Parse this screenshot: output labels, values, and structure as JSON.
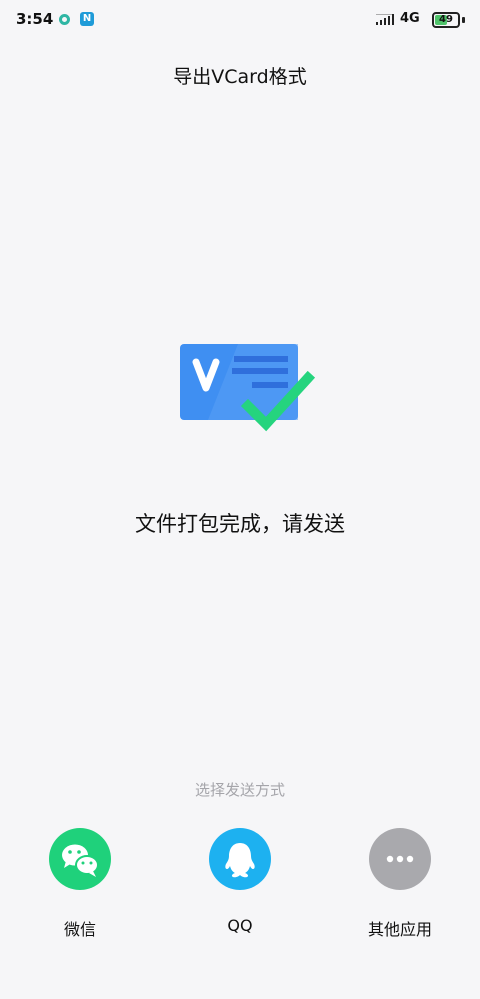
{
  "status_bar": {
    "time": "3:54",
    "network": "4G",
    "battery_level": "49",
    "battery_fraction": 0.49,
    "icons": [
      "app-ring-icon",
      "notification-n-icon",
      "signal-icon",
      "battery-icon"
    ]
  },
  "header": {
    "title": "导出VCard格式"
  },
  "main": {
    "illustration": "vcard-checkmark-icon",
    "message": "文件打包完成，请发送"
  },
  "share": {
    "prompt": "选择发送方式",
    "options": [
      {
        "label": "微信",
        "icon": "wechat-icon",
        "color": "#1fd17b"
      },
      {
        "label": "QQ",
        "icon": "qq-icon",
        "color": "#1db1f0"
      },
      {
        "label": "其他应用",
        "icon": "more-icon",
        "color": "#a9a9ad"
      }
    ]
  },
  "colors": {
    "card_blue": "#3f8ff2",
    "check_green": "#25d47e",
    "background": "#f6f6f8"
  }
}
